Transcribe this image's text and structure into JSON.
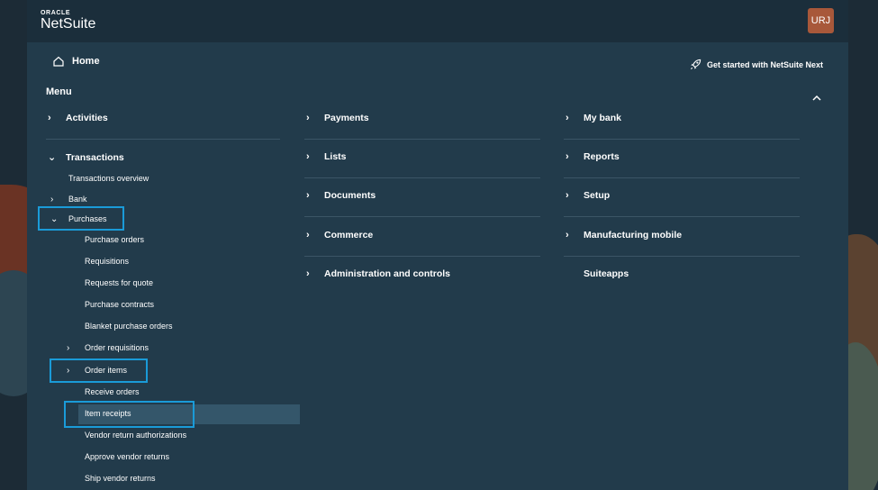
{
  "header": {
    "logo_top": "ORACLE",
    "logo_main": "NetSuite",
    "avatar_initials": "URJ"
  },
  "home": {
    "label": "Home"
  },
  "get_started": {
    "label": "Get started with NetSuite Next"
  },
  "menu": {
    "label": "Menu"
  },
  "col1": {
    "activities": "Activities",
    "transactions": "Transactions",
    "transactions_overview": "Transactions overview",
    "bank": "Bank",
    "purchases": "Purchases",
    "purchase_items": [
      "Purchase orders",
      "Requisitions",
      "Requests for quote",
      "Purchase contracts",
      "Blanket purchase orders",
      "Order requisitions",
      "Order items",
      "Receive orders",
      "Item receipts",
      "Vendor return authorizations",
      "Approve vendor returns",
      "Ship vendor returns"
    ]
  },
  "col2": [
    "Payments",
    "Lists",
    "Documents",
    "Commerce",
    "Administration and controls"
  ],
  "col3": [
    "My bank",
    "Reports",
    "Setup",
    "Manufacturing mobile",
    "Suiteapps"
  ],
  "colors": {
    "focus": "#1a9bd8",
    "panel": "#223b4b",
    "header": "#1b2e3b",
    "selected_row": "#34566a"
  }
}
